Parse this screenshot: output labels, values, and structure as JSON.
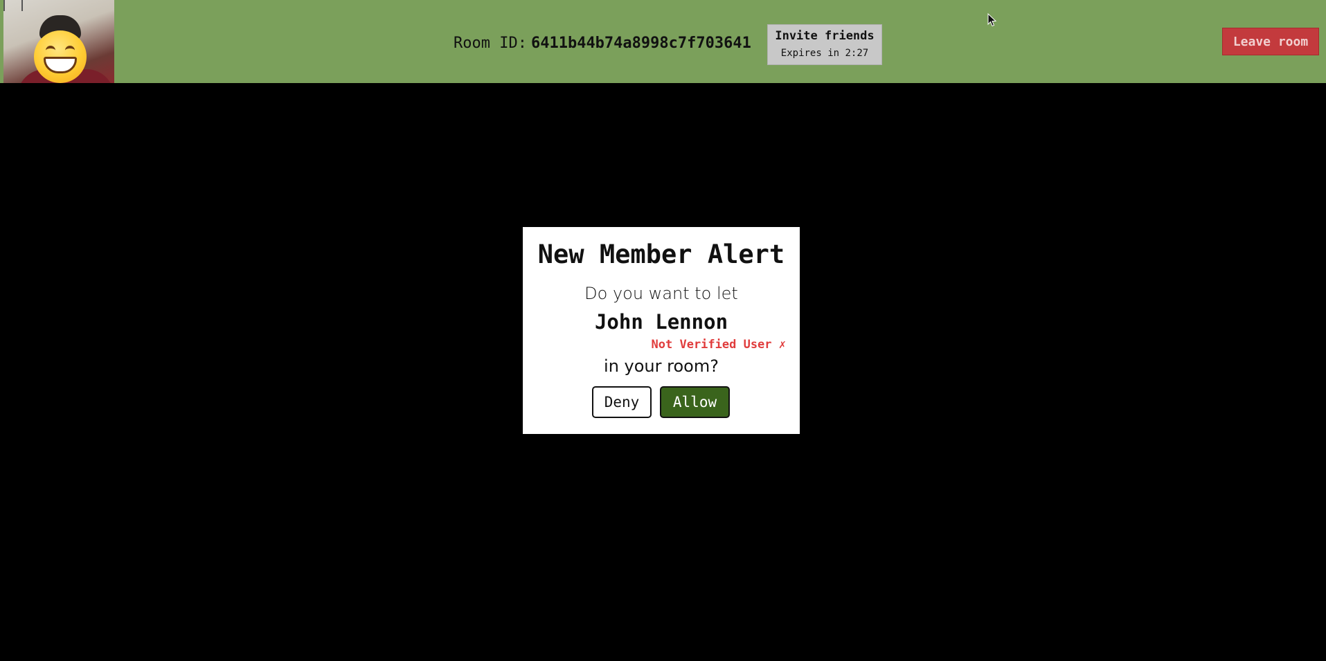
{
  "header": {
    "room_id_label": "Room ID:",
    "room_id_value": "6411b44b74a8998c7f703641",
    "invite_label": "Invite friends",
    "invite_expiry": "Expires in 2:27",
    "leave_label": "Leave room"
  },
  "video": {
    "overlay_emoji": "grinning-face-icon"
  },
  "modal": {
    "title": "New Member Alert",
    "prompt": "Do you want to let",
    "member_name": "John Lennon",
    "verification_status": "Not Verified User ✗",
    "suffix": "in your room?",
    "deny_label": "Deny",
    "allow_label": "Allow"
  },
  "colors": {
    "topbar": "#7ba05b",
    "leave": "#c33a3d",
    "allow": "#3a641c",
    "unverified": "#e03c3c"
  }
}
